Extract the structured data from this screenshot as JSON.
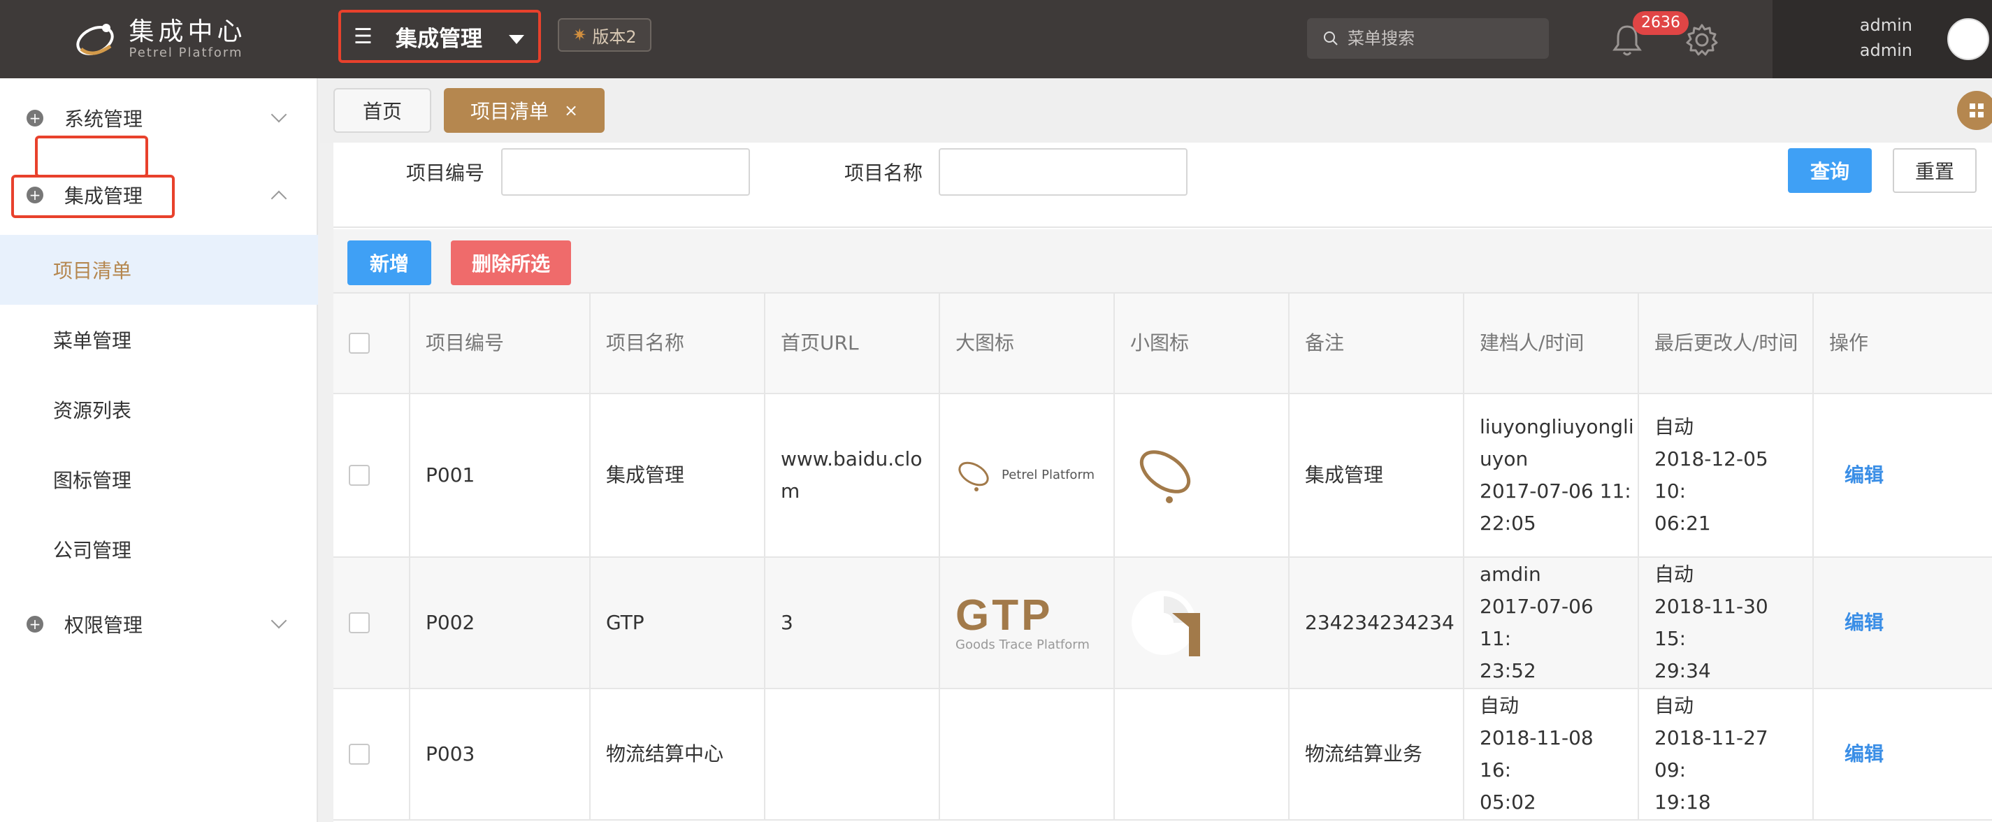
{
  "brand": {
    "title": "集成中心",
    "subtitle": "Petrel Platform"
  },
  "header": {
    "system_name": "集成管理",
    "version_label": "版本2",
    "search_placeholder": "菜单搜索",
    "notification_count": "2636",
    "user_line1": "admin",
    "user_line2": "admin"
  },
  "sidebar": {
    "groups": [
      {
        "label": "系统管理"
      },
      {
        "label": "集成管理"
      },
      {
        "label": "权限管理"
      }
    ],
    "items": [
      {
        "label": "项目清单"
      },
      {
        "label": "菜单管理"
      },
      {
        "label": "资源列表"
      },
      {
        "label": "图标管理"
      },
      {
        "label": "公司管理"
      }
    ]
  },
  "tabs": {
    "home": "首页",
    "active": "项目清单",
    "close": "×"
  },
  "search": {
    "code_label": "项目编号",
    "name_label": "项目名称",
    "code_value": "",
    "name_value": "",
    "query_button": "查询",
    "reset_button": "重置"
  },
  "toolbar": {
    "add_button": "新增",
    "delete_button": "删除所选"
  },
  "table": {
    "columns": [
      "项目编号",
      "项目名称",
      "首页URL",
      "大图标",
      "小图标",
      "备注",
      "建档人/时间",
      "最后更改人/时间",
      "操作"
    ],
    "rows": [
      {
        "code": "P001",
        "name": "集成管理",
        "url": "www.baidu.clo\nm",
        "large_icon_text": "Petrel Platform",
        "note": "集成管理",
        "created": "liuyongliuyongli\nuyon\n2017-07-06 11:\n22:05",
        "modified": "自动\n2018-12-05 10:\n06:21",
        "action": "编辑"
      },
      {
        "code": "P002",
        "name": "GTP",
        "url": "3",
        "large_icon_text": "GTP",
        "large_icon_sub": "Goods Trace Platform",
        "note": "234234234234",
        "created": "amdin\n2017-07-06 11:\n23:52",
        "modified": "自动\n2018-11-30 15:\n29:34",
        "action": "编辑"
      },
      {
        "code": "P003",
        "name": "物流结算中心",
        "url": "",
        "note": "物流结算业务",
        "created": "自动\n2018-11-08 16:\n05:02",
        "modified": "自动\n2018-11-27 09:\n19:18",
        "action": "编辑"
      }
    ]
  },
  "colors": {
    "topbar": "#3e3a39",
    "accent": "#b5874f",
    "primary": "#3fa0f5",
    "danger": "#ef6b6b",
    "highlight": "#e8412c"
  }
}
